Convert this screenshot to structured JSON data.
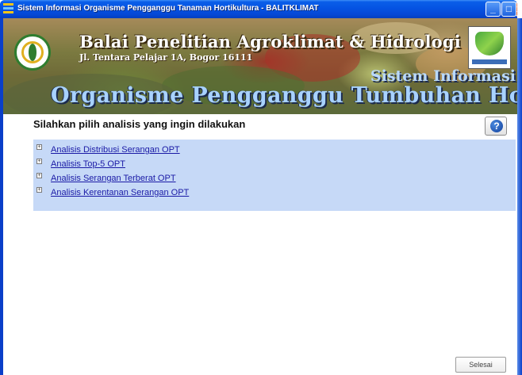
{
  "window": {
    "title": "Sistem Informasi Organisme Pengganggu Tanaman Hortikultura - BALITKLIMAT",
    "icon": "app-icon",
    "controls": {
      "minimize": "_",
      "maximize": "□",
      "close": "x"
    }
  },
  "banner": {
    "institution": "Balai Penelitian Agroklimat & Hidrologi",
    "address": "Jl. Tentara Pelajar 1A, Bogor 16111",
    "line1": "Sistem Informasi",
    "line2": "Organisme Pengganggu Tumbuhan Hortikultura"
  },
  "main": {
    "heading": "Silahkan pilih analisis yang ingin dilakukan",
    "help_icon": "question-icon",
    "help_glyph": "?",
    "menu_items": [
      {
        "label": "Analisis Distribusi Serangan OPT",
        "expand": "+"
      },
      {
        "label": "Analisis Top-5 OPT",
        "expand": "+"
      },
      {
        "label": "Analisis Serangan Terberat OPT",
        "expand": "+"
      },
      {
        "label": "Analisis Kerentanan Serangan OPT",
        "expand": "+"
      }
    ],
    "menu_bg": "#c6d9f7",
    "link_color": "#1a1aa6",
    "done_label": "Selesai"
  }
}
